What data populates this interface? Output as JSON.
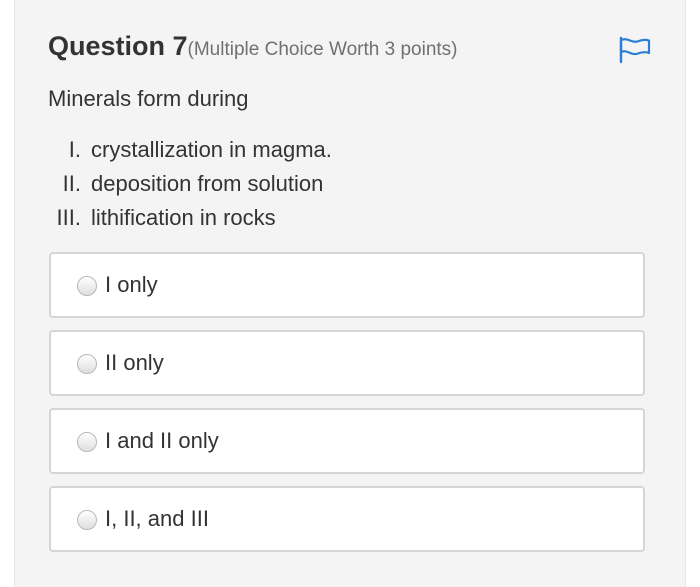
{
  "question": {
    "title": "Question 7",
    "subtitle": "(Multiple Choice Worth 3 points)",
    "prompt": "Minerals form during",
    "statements": [
      {
        "num": "I.",
        "text": "crystallization in magma."
      },
      {
        "num": "II.",
        "text": "deposition from solution"
      },
      {
        "num": "III.",
        "text": "lithification in rocks"
      }
    ]
  },
  "flag": {
    "icon": "flag-icon",
    "color": "#2a7fd4"
  },
  "options": [
    {
      "label": "I only",
      "selected": false
    },
    {
      "label": "II only",
      "selected": false
    },
    {
      "label": "I and II only",
      "selected": false
    },
    {
      "label": "I, II, and III",
      "selected": false
    }
  ]
}
